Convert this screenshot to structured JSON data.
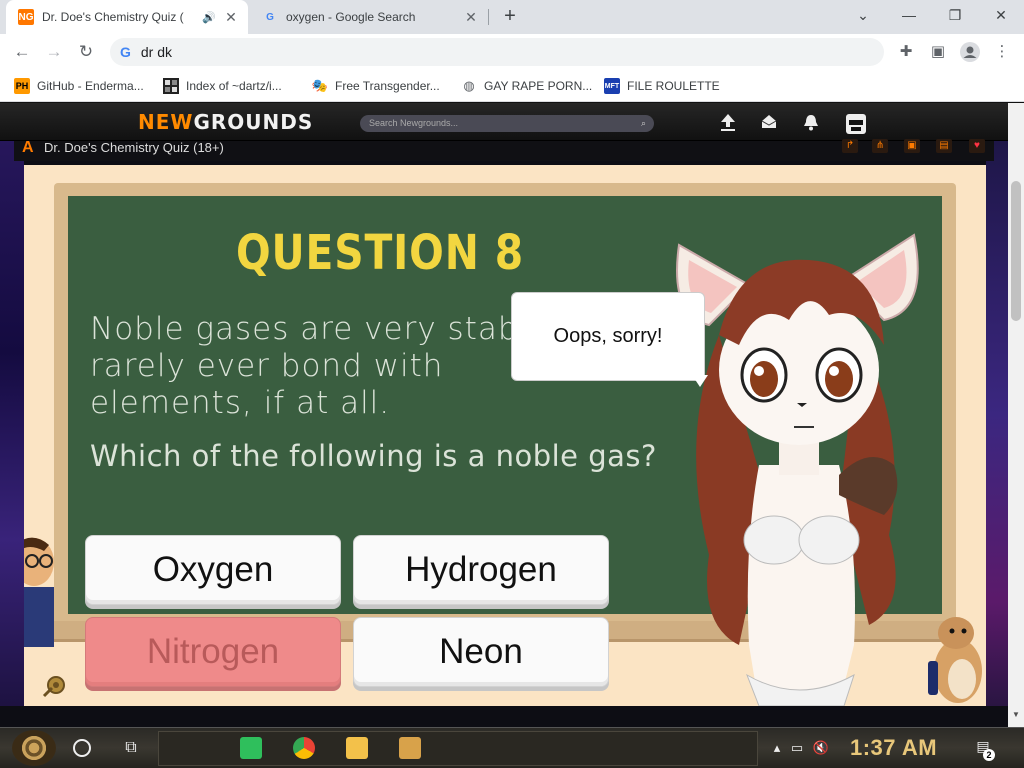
{
  "browser": {
    "tabs": [
      {
        "title": "Dr. Doe's Chemistry Quiz (",
        "favicon": "NG",
        "active": true,
        "audio": true
      },
      {
        "title": "oxygen - Google Search",
        "favicon": "G",
        "active": false
      }
    ],
    "new_tab": "+",
    "window_controls": {
      "minimize": "—",
      "restore": "❐",
      "close": "✕",
      "tab_search": "⌄"
    },
    "address": "dr dk",
    "bookmarks": [
      {
        "label": "GitHub - Enderma...",
        "icon": "PH"
      },
      {
        "label": "Index of ~dartz/i...",
        "icon": "grid"
      },
      {
        "label": "Free Transgender...",
        "icon": "mask"
      },
      {
        "label": "GAY RAPE PORN...",
        "icon": "globe"
      },
      {
        "label": "FILE ROULETTE",
        "icon": "MFT"
      }
    ]
  },
  "newgrounds": {
    "logo_new": "NEW",
    "logo_grounds": "GROUNDS",
    "search_placeholder": "Search Newgrounds...",
    "game_title": "Dr. Doe's Chemistry Quiz (18+)"
  },
  "game": {
    "question_title": "QUESTION 8",
    "question_text": "Noble gases are very stab rarely ever bond with elements, if at all.",
    "question_prompt": "Which of the following is a noble gas?",
    "answers": [
      {
        "label": "Oxygen",
        "state": "normal"
      },
      {
        "label": "Hydrogen",
        "state": "normal"
      },
      {
        "label": "Nitrogen",
        "state": "wrong"
      },
      {
        "label": "Neon",
        "state": "normal"
      }
    ],
    "speech_bubble": "Oops, sorry!"
  },
  "taskbar": {
    "clock": "1:37 AM",
    "notification_count": "2"
  }
}
